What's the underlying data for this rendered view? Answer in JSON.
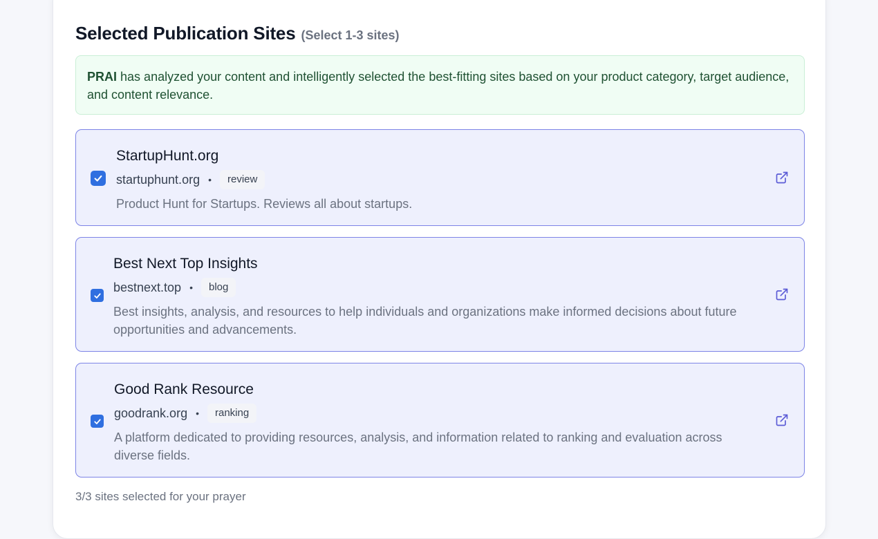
{
  "header": {
    "title": "Selected Publication Sites",
    "hint": "(Select 1-3 sites)"
  },
  "notice": {
    "brand": "PRAI",
    "text": "has analyzed your content and intelligently selected the best-fitting sites based on your product category, target audience, and content relevance."
  },
  "sites": [
    {
      "name": "StartupHunt.org",
      "domain": "startuphunt.org",
      "tag": "review",
      "description": "Product Hunt for Startups. Reviews all about startups.",
      "checked": true
    },
    {
      "name": "Best Next Top Insights",
      "domain": "bestnext.top",
      "tag": "blog",
      "description": "Best insights, analysis, and resources to help individuals and organizations make informed decisions about future opportunities and advancements.",
      "checked": true
    },
    {
      "name": "Good Rank Resource",
      "domain": "goodrank.org",
      "tag": "ranking",
      "description": "A platform dedicated to providing resources, analysis, and information related to ranking and evaluation across diverse fields.",
      "checked": true
    }
  ],
  "separator": "•",
  "footer": {
    "selection_text": "3/3 sites selected for your prayer"
  },
  "colors": {
    "checkbox": "#2f6fe0",
    "card_border": "#7c83e6",
    "card_background": "#eef0fd",
    "notice_background": "#f0fdf4",
    "link_icon": "#5b5bd6"
  },
  "icons": {
    "checkbox": "checkmark-icon",
    "open_link": "external-link-icon"
  }
}
